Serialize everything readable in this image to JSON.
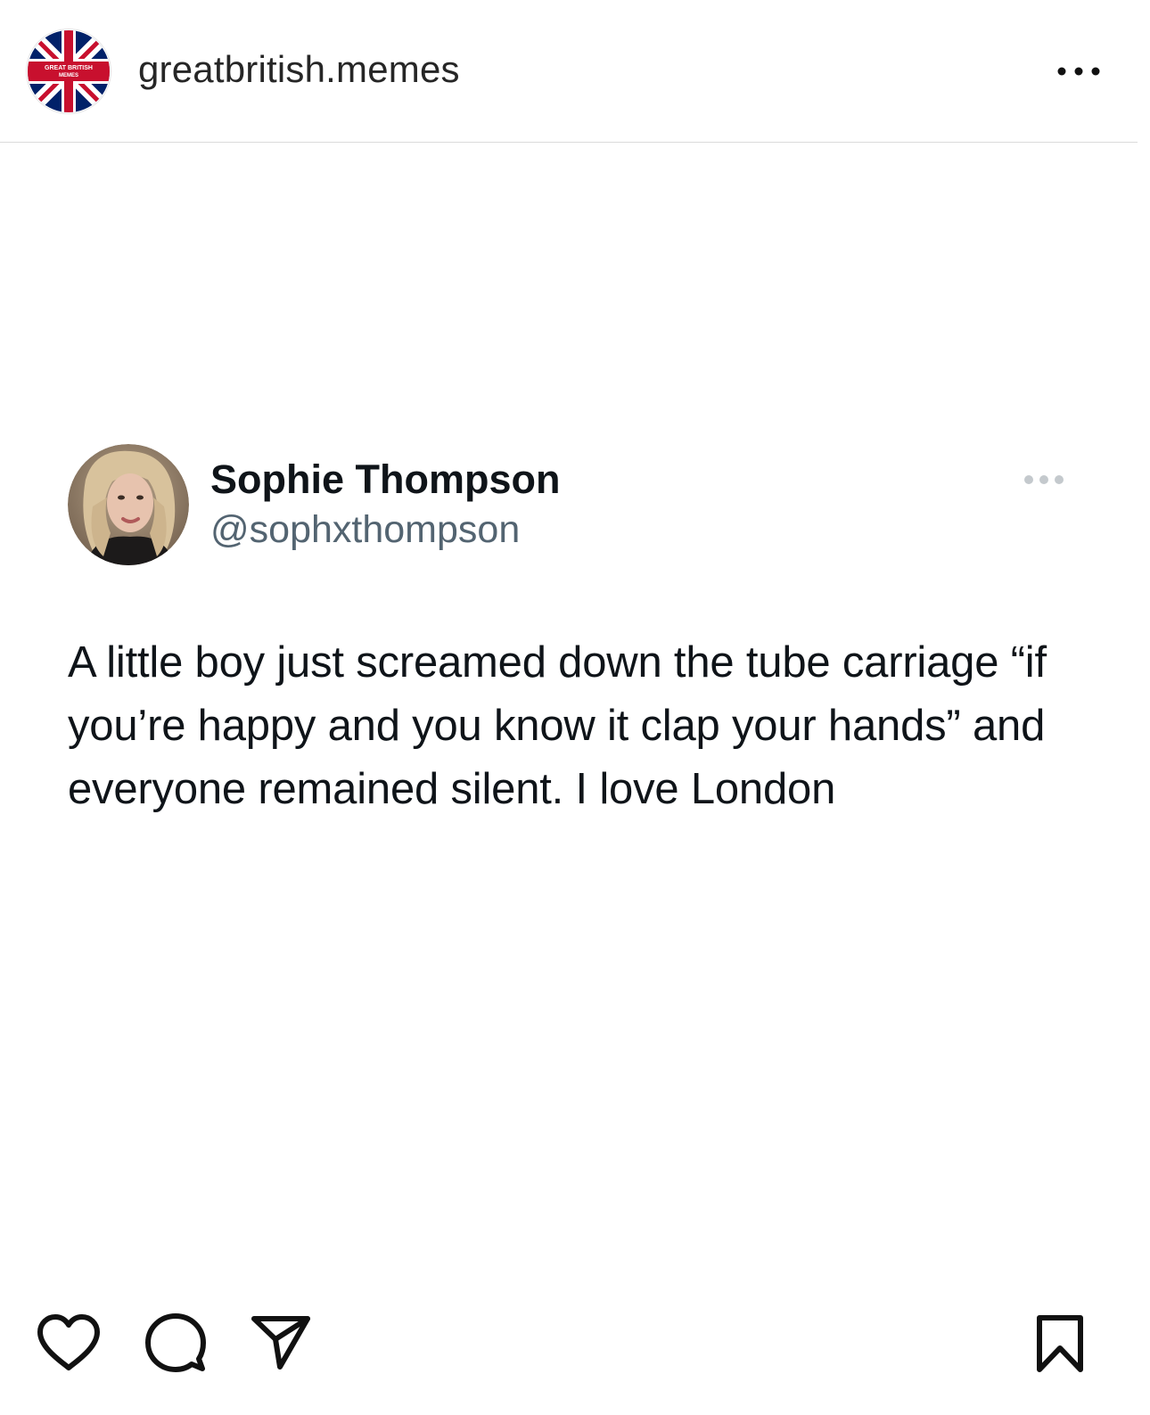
{
  "header": {
    "account_name": "greatbritish.memes",
    "avatar_text_line1": "GREAT BRITISH",
    "avatar_text_line2": "MEMES",
    "more_icon": "more-horizontal-icon"
  },
  "tweet": {
    "display_name": "Sophie Thompson",
    "handle": "@sophxthompson",
    "text": "A little boy just screamed down the tube carriage “if you’re happy and you know it clap your hands” and everyone remained silent. I love London",
    "more_icon": "more-horizontal-icon"
  },
  "actions": {
    "like_icon": "heart-icon",
    "comment_icon": "comment-icon",
    "share_icon": "send-icon",
    "save_icon": "bookmark-icon"
  },
  "colors": {
    "union_red": "#c8102e",
    "union_blue": "#012169",
    "handle_gray": "#536471",
    "divider": "#dbdbdb"
  }
}
